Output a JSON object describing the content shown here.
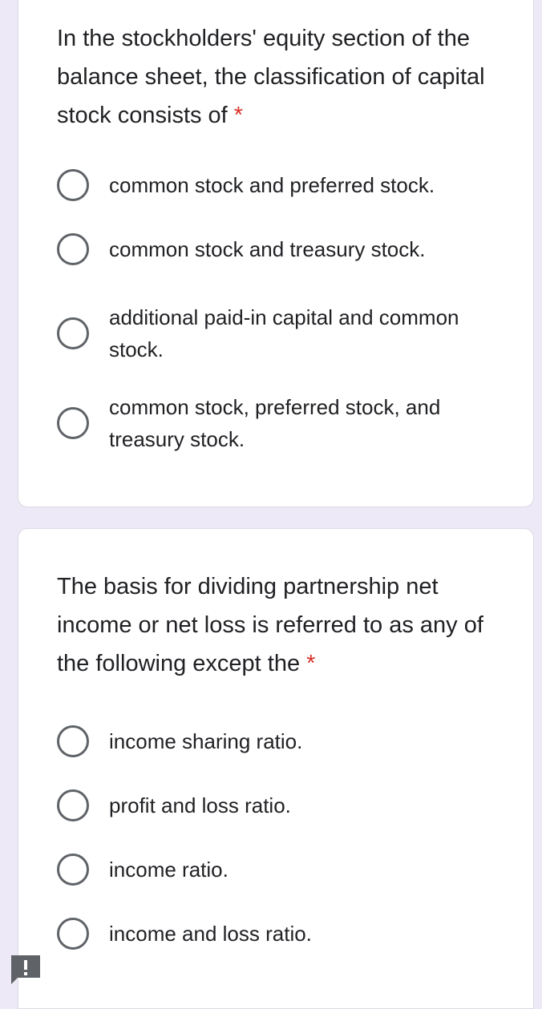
{
  "questions": [
    {
      "title": "In the stockholders' equity section of the balance sheet, the classification of capital stock consists of",
      "required_marker": "*",
      "options": [
        "common stock and preferred stock.",
        "common stock and treasury stock.",
        "additional paid-in capital and common stock.",
        "common stock, preferred stock, and treasury stock."
      ]
    },
    {
      "title": "The basis for dividing partnership net income or net loss is referred to as any of the following except the",
      "required_marker": "*",
      "options": [
        "income sharing ratio.",
        "profit and loss ratio.",
        "income ratio.",
        "income and loss ratio."
      ]
    }
  ],
  "colors": {
    "background": "#ede9f6",
    "card": "#ffffff",
    "required": "#d93025",
    "radio_border": "#5f6368",
    "text": "#202124"
  },
  "icons": {
    "feedback": "feedback-icon"
  }
}
